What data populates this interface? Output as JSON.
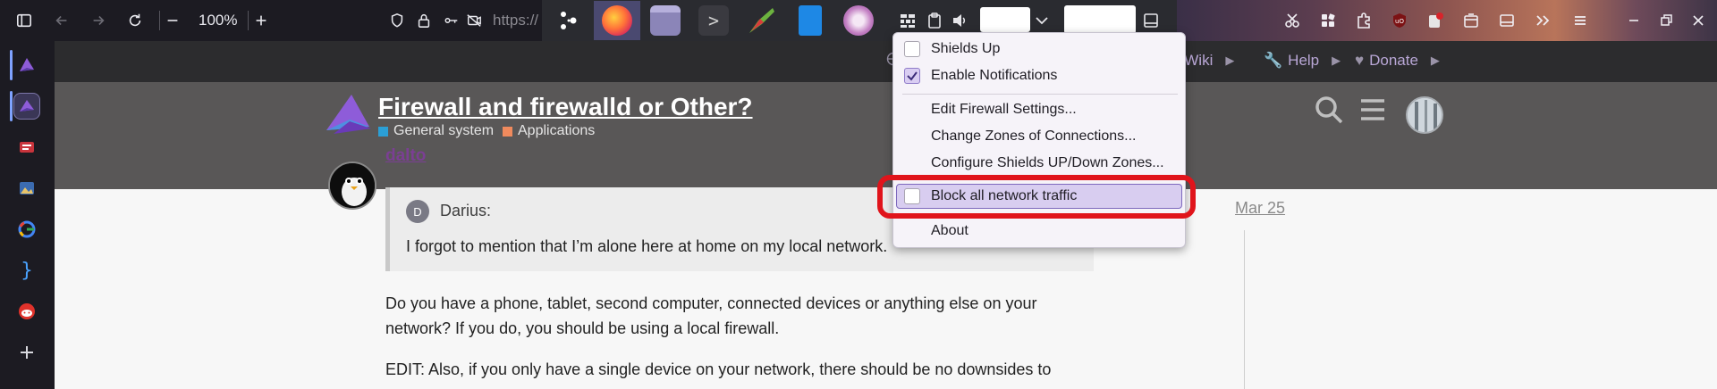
{
  "toolbar": {
    "zoom": "100%",
    "url": "https://"
  },
  "header": {
    "nav": [
      {
        "label": "Wiki"
      },
      {
        "label": "Help"
      },
      {
        "label": "Donate"
      }
    ],
    "title": "Firewall and firewalld or Other?",
    "categories": [
      {
        "label": "General system",
        "color": "#2b9fd6"
      },
      {
        "label": "Applications",
        "color": "#f08a5d"
      }
    ]
  },
  "post": {
    "username": "dalto",
    "quote": {
      "avatar_letter": "D",
      "author": "Darius:",
      "text": "I forgot to mention that I’m alone here at home on my local network."
    },
    "date": "Mar 25",
    "paragraph1": "Do you have a phone, tablet, second computer, connected devices or anything else on your network? If you do, you should be using a local firewall.",
    "paragraph2": "EDIT: Also, if you only have a single device on your network, there should be no downsides to"
  },
  "menu": {
    "items": [
      {
        "label": "Shields Up",
        "checkbox": true,
        "checked": false
      },
      {
        "label": "Enable Notifications",
        "checkbox": true,
        "checked": true
      },
      {
        "label": "Edit Firewall Settings..."
      },
      {
        "label": "Change Zones of Connections..."
      },
      {
        "label": "Configure Shields UP/Down Zones..."
      },
      {
        "label": "Block all network traffic",
        "checkbox": true,
        "checked": false
      },
      {
        "label": "About"
      }
    ]
  },
  "colors": {
    "accent": "#7d68bd",
    "highlight_box": "#e0141b",
    "username": "#7b3f93"
  }
}
